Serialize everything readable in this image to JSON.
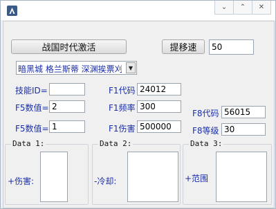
{
  "window": {
    "icon": "app-icon"
  },
  "titlebar": {
    "minimize": "⌄",
    "maximize": "⌃",
    "close": "✕"
  },
  "top": {
    "activate_button": "战国时代激活",
    "speed_button": "提移速",
    "speed_value": "50"
  },
  "combo": {
    "value": "暗黑城 格兰斯蒂 深渊挨票刈"
  },
  "fields": {
    "skill_id_label": "技能ID=",
    "skill_id_value": "",
    "f5_value_label_1": "F5数值=",
    "f5_value_1": "2",
    "f5_value_label_2": "F5数值=",
    "f5_value_2": "1",
    "f1_code_label": "F1代码",
    "f1_code_value": "24012",
    "f1_freq_label": "F1频率",
    "f1_freq_value": "300",
    "f1_damage_label": "F1伤害",
    "f1_damage_value": "500000",
    "f8_code_label": "F8代码",
    "f8_code_value": "56015",
    "f8_level_label": "F8等级",
    "f8_level_value": "30"
  },
  "groups": [
    {
      "title": "Data 1:",
      "label": "+伤害:"
    },
    {
      "title": "Data 2:",
      "label": "-冷却:"
    },
    {
      "title": "Data 3:",
      "label": "+范围"
    }
  ]
}
